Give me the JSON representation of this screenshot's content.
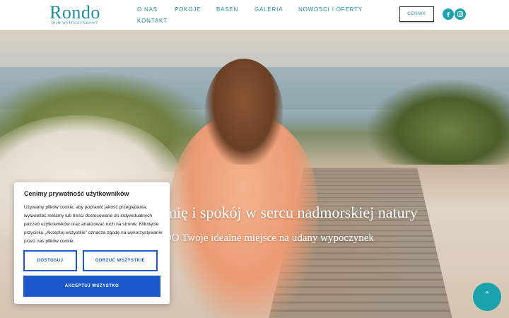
{
  "header": {
    "logo_text": "Rondo",
    "logo_subtitle": "DOM WYPOCZYNKOWY",
    "nav": [
      "O NAS",
      "POKOJE",
      "BASEN",
      "GALERIA",
      "NOWOSCI I OFERTY",
      "KONTAKT"
    ],
    "cta_label": "CENNIK",
    "social": [
      "facebook-icon",
      "instagram-icon"
    ]
  },
  "hero": {
    "title": "onię i spokój w sercu nadmorskiej natury",
    "subtitle": "DO  Twoje idealne miejsce na udany wypoczynek"
  },
  "cookie": {
    "title": "Cenimy prywatność użytkowników",
    "text": "Używamy plików cookie, aby poprawić jakość przeglądania, wyświetlać reklamy lub treści dostosowane do indywidualnych potrzeb użytkowników oraz analizować ruch na stronie. Kliknięcie przycisku „Akceptuj wszystkie” oznacza zgodę na wykorzystywanie przez nas plików cookie.",
    "customize_label": "DOSTOSUJ",
    "reject_label": "ODRZUĆ WSZYSTKIE",
    "accept_label": "AKCEPTUJ WSZYSTKO"
  },
  "scroll_top_icon": "chevron-up-icon",
  "colors": {
    "brand_teal": "#1aa3ad",
    "cookie_blue": "#1b58c9"
  }
}
